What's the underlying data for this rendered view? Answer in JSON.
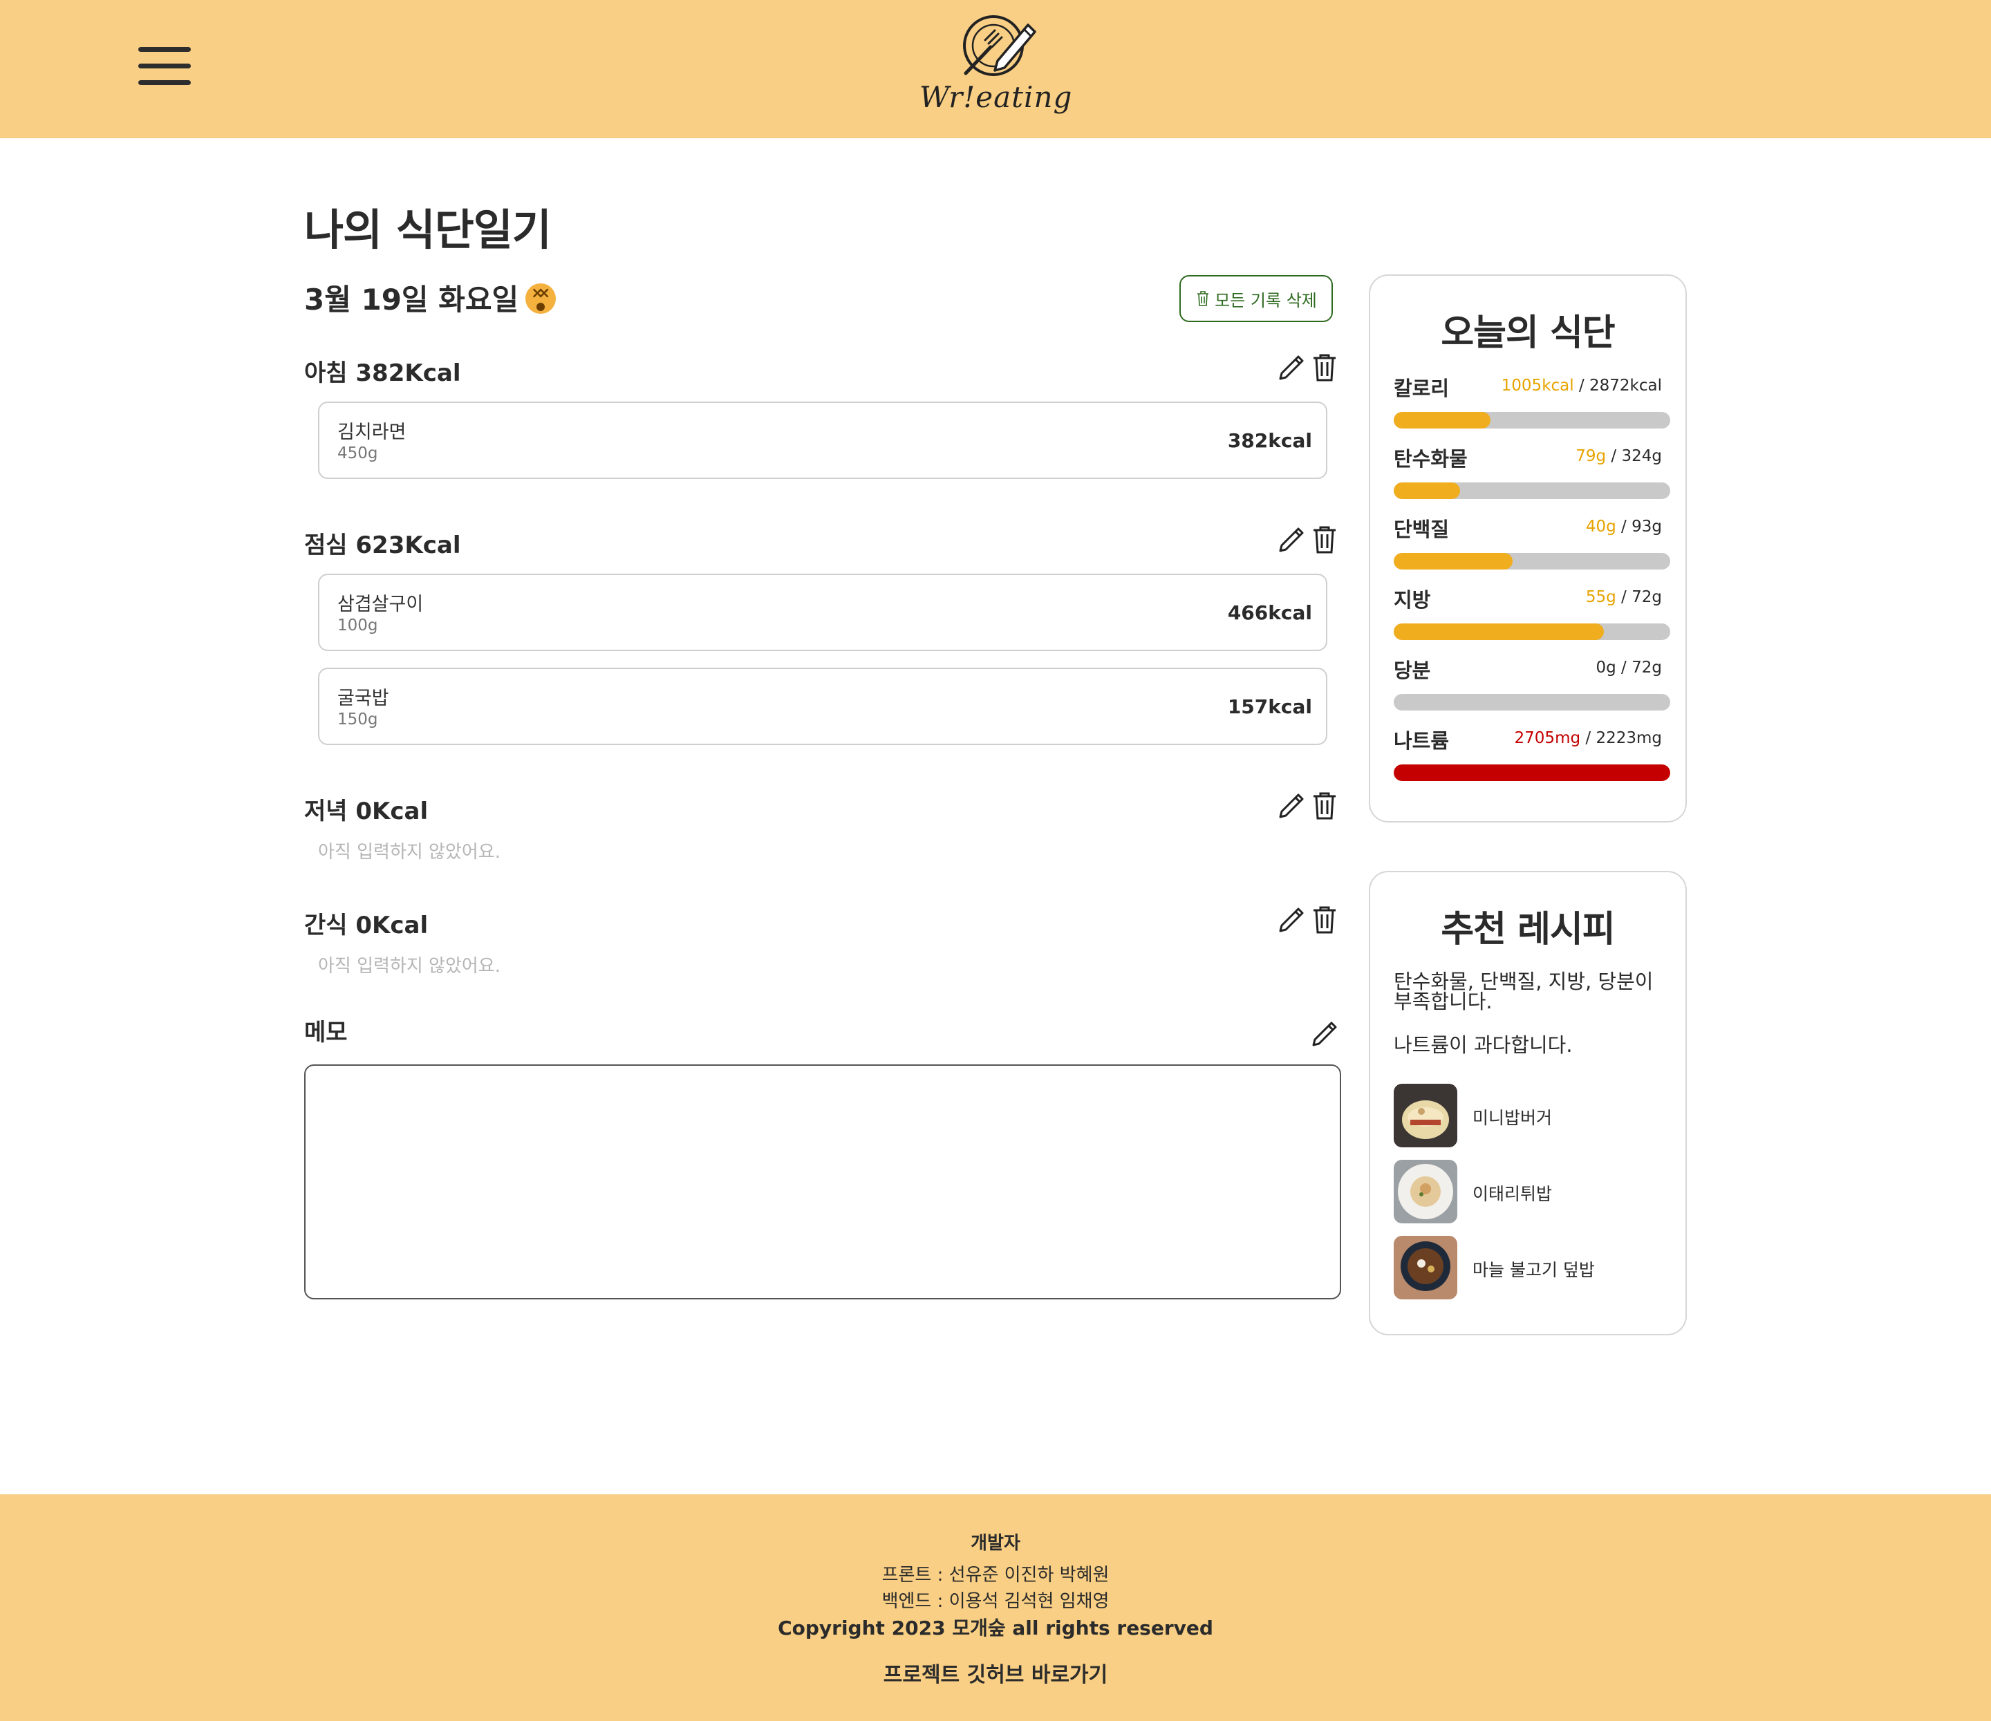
{
  "header": {
    "logo_text": "Wr!eating",
    "menu_icon": "hamburger-menu-icon",
    "logo_icon": "plate-fork-pencil-icon"
  },
  "page": {
    "title": "나의 식단일기",
    "date": "3월 19일 화요일",
    "mood_icon": "dizzy-face-emoji"
  },
  "toolbar": {
    "delete_all_label": "모든 기록 삭제"
  },
  "meals": [
    {
      "label": "아침 382Kcal",
      "items": [
        {
          "name": "김치라면",
          "weight": "450g",
          "kcal": "382kcal"
        }
      ]
    },
    {
      "label": "점심 623Kcal",
      "items": [
        {
          "name": "삼겹살구이",
          "weight": "100g",
          "kcal": "466kcal"
        },
        {
          "name": "굴국밥",
          "weight": "150g",
          "kcal": "157kcal"
        }
      ]
    },
    {
      "label": "저녁 0Kcal",
      "empty_message": "아직 입력하지 않았어요."
    },
    {
      "label": "간식 0Kcal",
      "empty_message": "아직 입력하지 않았어요."
    }
  ],
  "memo": {
    "label": "메모",
    "value": ""
  },
  "today": {
    "title": "오늘의 식단",
    "nutrients": [
      {
        "label": "칼로리",
        "current": "1005kcal",
        "target": "2872kcal",
        "ratio": 0.35,
        "status": "normal"
      },
      {
        "label": "탄수화물",
        "current": "79g",
        "target": "324g",
        "ratio": 0.24,
        "status": "normal"
      },
      {
        "label": "단백질",
        "current": "40g",
        "target": "93g",
        "ratio": 0.43,
        "status": "normal"
      },
      {
        "label": "지방",
        "current": "55g",
        "target": "72g",
        "ratio": 0.76,
        "status": "normal"
      },
      {
        "label": "당분",
        "current": "0g",
        "target": "72g",
        "ratio": 0,
        "status": "none"
      },
      {
        "label": "나트륨",
        "current": "2705mg",
        "target": "2223mg",
        "ratio": 1,
        "status": "over"
      }
    ],
    "colors": {
      "fill": "#f0ad1e",
      "over": "#c40000",
      "track": "#c9c9c9"
    }
  },
  "recipes": {
    "title": "추천 레시피",
    "message_lack": "탄수화물, 단백질, 지방, 당분이 부족합니다.",
    "message_over": "나트륨이 과다합니다.",
    "items": [
      {
        "name": "미니밥버거"
      },
      {
        "name": "이태리튀밥"
      },
      {
        "name": "마늘 불고기 덮밥"
      }
    ]
  },
  "footer": {
    "heading": "개발자",
    "front": "프론트 : 선유준 이진하 박혜원",
    "back": "백엔드 : 이용석 김석현 임채영",
    "copyright": "Copyright 2023 모개숲 all rights reserved",
    "github_link": "프로젝트 깃허브 바로가기"
  },
  "theme": {
    "header_bg": "#f8cf84",
    "accent_green": "#2d6a1f"
  }
}
